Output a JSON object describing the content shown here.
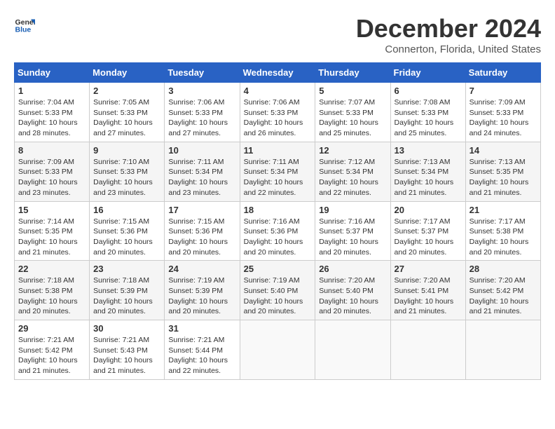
{
  "logo": {
    "text_general": "General",
    "text_blue": "Blue"
  },
  "title": "December 2024",
  "location": "Connerton, Florida, United States",
  "days_of_week": [
    "Sunday",
    "Monday",
    "Tuesday",
    "Wednesday",
    "Thursday",
    "Friday",
    "Saturday"
  ],
  "weeks": [
    [
      {
        "day": "1",
        "sunrise": "7:04 AM",
        "sunset": "5:33 PM",
        "daylight": "10 hours and 28 minutes."
      },
      {
        "day": "2",
        "sunrise": "7:05 AM",
        "sunset": "5:33 PM",
        "daylight": "10 hours and 27 minutes."
      },
      {
        "day": "3",
        "sunrise": "7:06 AM",
        "sunset": "5:33 PM",
        "daylight": "10 hours and 27 minutes."
      },
      {
        "day": "4",
        "sunrise": "7:06 AM",
        "sunset": "5:33 PM",
        "daylight": "10 hours and 26 minutes."
      },
      {
        "day": "5",
        "sunrise": "7:07 AM",
        "sunset": "5:33 PM",
        "daylight": "10 hours and 25 minutes."
      },
      {
        "day": "6",
        "sunrise": "7:08 AM",
        "sunset": "5:33 PM",
        "daylight": "10 hours and 25 minutes."
      },
      {
        "day": "7",
        "sunrise": "7:09 AM",
        "sunset": "5:33 PM",
        "daylight": "10 hours and 24 minutes."
      }
    ],
    [
      {
        "day": "8",
        "sunrise": "7:09 AM",
        "sunset": "5:33 PM",
        "daylight": "10 hours and 23 minutes."
      },
      {
        "day": "9",
        "sunrise": "7:10 AM",
        "sunset": "5:33 PM",
        "daylight": "10 hours and 23 minutes."
      },
      {
        "day": "10",
        "sunrise": "7:11 AM",
        "sunset": "5:34 PM",
        "daylight": "10 hours and 23 minutes."
      },
      {
        "day": "11",
        "sunrise": "7:11 AM",
        "sunset": "5:34 PM",
        "daylight": "10 hours and 22 minutes."
      },
      {
        "day": "12",
        "sunrise": "7:12 AM",
        "sunset": "5:34 PM",
        "daylight": "10 hours and 22 minutes."
      },
      {
        "day": "13",
        "sunrise": "7:13 AM",
        "sunset": "5:34 PM",
        "daylight": "10 hours and 21 minutes."
      },
      {
        "day": "14",
        "sunrise": "7:13 AM",
        "sunset": "5:35 PM",
        "daylight": "10 hours and 21 minutes."
      }
    ],
    [
      {
        "day": "15",
        "sunrise": "7:14 AM",
        "sunset": "5:35 PM",
        "daylight": "10 hours and 21 minutes."
      },
      {
        "day": "16",
        "sunrise": "7:15 AM",
        "sunset": "5:36 PM",
        "daylight": "10 hours and 20 minutes."
      },
      {
        "day": "17",
        "sunrise": "7:15 AM",
        "sunset": "5:36 PM",
        "daylight": "10 hours and 20 minutes."
      },
      {
        "day": "18",
        "sunrise": "7:16 AM",
        "sunset": "5:36 PM",
        "daylight": "10 hours and 20 minutes."
      },
      {
        "day": "19",
        "sunrise": "7:16 AM",
        "sunset": "5:37 PM",
        "daylight": "10 hours and 20 minutes."
      },
      {
        "day": "20",
        "sunrise": "7:17 AM",
        "sunset": "5:37 PM",
        "daylight": "10 hours and 20 minutes."
      },
      {
        "day": "21",
        "sunrise": "7:17 AM",
        "sunset": "5:38 PM",
        "daylight": "10 hours and 20 minutes."
      }
    ],
    [
      {
        "day": "22",
        "sunrise": "7:18 AM",
        "sunset": "5:38 PM",
        "daylight": "10 hours and 20 minutes."
      },
      {
        "day": "23",
        "sunrise": "7:18 AM",
        "sunset": "5:39 PM",
        "daylight": "10 hours and 20 minutes."
      },
      {
        "day": "24",
        "sunrise": "7:19 AM",
        "sunset": "5:39 PM",
        "daylight": "10 hours and 20 minutes."
      },
      {
        "day": "25",
        "sunrise": "7:19 AM",
        "sunset": "5:40 PM",
        "daylight": "10 hours and 20 minutes."
      },
      {
        "day": "26",
        "sunrise": "7:20 AM",
        "sunset": "5:40 PM",
        "daylight": "10 hours and 20 minutes."
      },
      {
        "day": "27",
        "sunrise": "7:20 AM",
        "sunset": "5:41 PM",
        "daylight": "10 hours and 21 minutes."
      },
      {
        "day": "28",
        "sunrise": "7:20 AM",
        "sunset": "5:42 PM",
        "daylight": "10 hours and 21 minutes."
      }
    ],
    [
      {
        "day": "29",
        "sunrise": "7:21 AM",
        "sunset": "5:42 PM",
        "daylight": "10 hours and 21 minutes."
      },
      {
        "day": "30",
        "sunrise": "7:21 AM",
        "sunset": "5:43 PM",
        "daylight": "10 hours and 21 minutes."
      },
      {
        "day": "31",
        "sunrise": "7:21 AM",
        "sunset": "5:44 PM",
        "daylight": "10 hours and 22 minutes."
      },
      null,
      null,
      null,
      null
    ]
  ]
}
